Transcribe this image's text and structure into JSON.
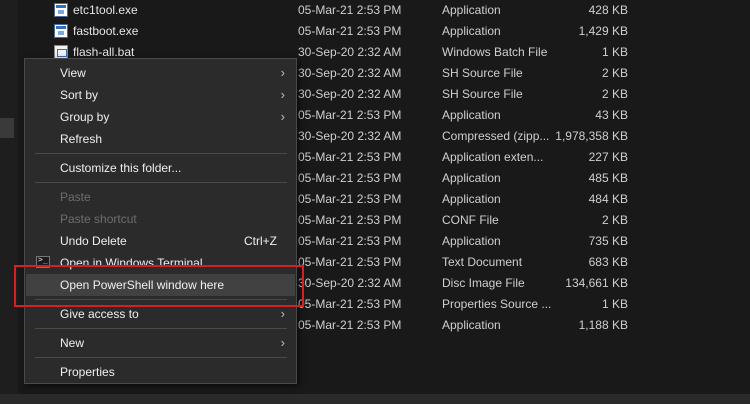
{
  "files": [
    {
      "name": "etc1tool.exe",
      "date": "05-Mar-21 2:53 PM",
      "type": "Application",
      "size": "428 KB",
      "icon": "application-icon"
    },
    {
      "name": "fastboot.exe",
      "date": "05-Mar-21 2:53 PM",
      "type": "Application",
      "size": "1,429 KB",
      "icon": "application-icon"
    },
    {
      "name": "flash-all.bat",
      "date": "30-Sep-20 2:32 AM",
      "type": "Windows Batch File",
      "size": "1 KB",
      "icon": "batch-file-icon"
    },
    {
      "name": "",
      "date": "30-Sep-20 2:32 AM",
      "type": "SH Source File",
      "size": "2 KB"
    },
    {
      "name": "",
      "date": "30-Sep-20 2:32 AM",
      "type": "SH Source File",
      "size": "2 KB"
    },
    {
      "name": "",
      "date": "05-Mar-21 2:53 PM",
      "type": "Application",
      "size": "43 KB"
    },
    {
      "name": "",
      "date": "30-Sep-20 2:32 AM",
      "type": "Compressed (zipp...",
      "size": "1,978,358 KB"
    },
    {
      "name": "",
      "date": "05-Mar-21 2:53 PM",
      "type": "Application exten...",
      "size": "227 KB"
    },
    {
      "name": "",
      "date": "05-Mar-21 2:53 PM",
      "type": "Application",
      "size": "485 KB"
    },
    {
      "name": "",
      "date": "05-Mar-21 2:53 PM",
      "type": "Application",
      "size": "484 KB"
    },
    {
      "name": "",
      "date": "05-Mar-21 2:53 PM",
      "type": "CONF File",
      "size": "2 KB"
    },
    {
      "name": "",
      "date": "05-Mar-21 2:53 PM",
      "type": "Application",
      "size": "735 KB"
    },
    {
      "name": "",
      "date": "05-Mar-21 2:53 PM",
      "type": "Text Document",
      "size": "683 KB"
    },
    {
      "name": "",
      "date": "30-Sep-20 2:32 AM",
      "type": "Disc Image File",
      "size": "134,661 KB"
    },
    {
      "name": "",
      "date": "05-Mar-21 2:53 PM",
      "type": "Properties Source ...",
      "size": "1 KB"
    },
    {
      "name": "",
      "date": "05-Mar-21 2:53 PM",
      "type": "Application",
      "size": "1,188 KB"
    }
  ],
  "context_menu": {
    "view": "View",
    "sort_by": "Sort by",
    "group_by": "Group by",
    "refresh": "Refresh",
    "customize": "Customize this folder...",
    "paste": "Paste",
    "paste_shortcut": "Paste shortcut",
    "undo_delete": "Undo Delete",
    "undo_shortcut": "Ctrl+Z",
    "open_terminal": "Open in Windows Terminal",
    "open_powershell": "Open PowerShell window here",
    "give_access": "Give access to",
    "new": "New",
    "properties": "Properties",
    "submenu_arrow": "›"
  },
  "colors": {
    "background": "#191919",
    "menu_background": "#2b2b2b",
    "menu_hover": "#414141",
    "highlight_box": "#d62020"
  }
}
